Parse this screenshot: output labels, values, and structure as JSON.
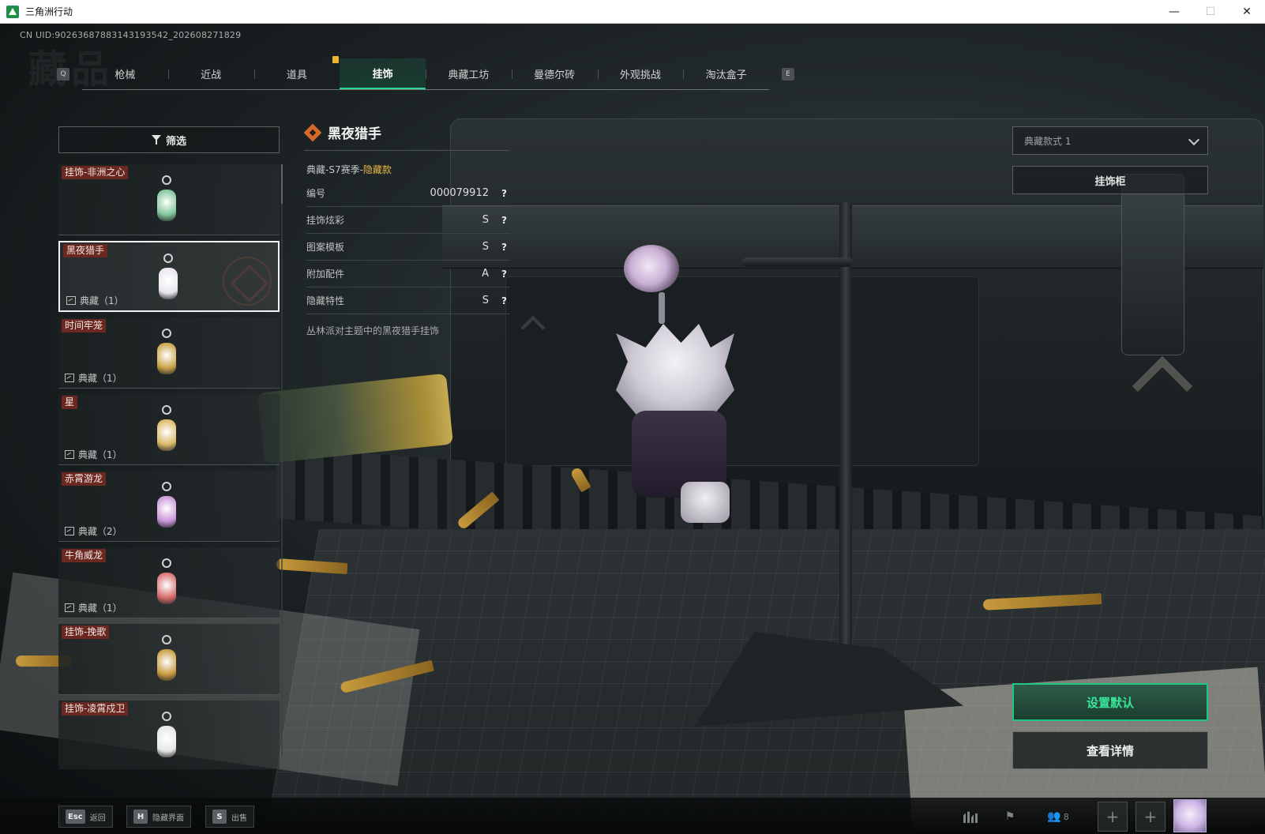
{
  "window": {
    "title": "三角洲行动",
    "controls": {
      "minimize": "—",
      "maximize": "☐",
      "close": "✕"
    }
  },
  "header": {
    "uid": "CN UID:9026368788314319354​2_202608271829",
    "watermark": "藏品",
    "key_left": "Q",
    "key_right": "E"
  },
  "tabs": [
    {
      "label": "枪械"
    },
    {
      "label": "近战"
    },
    {
      "label": "道具"
    },
    {
      "label": "挂饰",
      "active": true
    },
    {
      "label": "典藏工坊"
    },
    {
      "label": "曼德尔砖"
    },
    {
      "label": "外观挑战"
    },
    {
      "label": "淘汰盒子"
    }
  ],
  "filter": {
    "label": "筛选"
  },
  "items": [
    {
      "name": "挂饰-非洲之心",
      "tag": "",
      "thumb_color": "#7fc59a"
    },
    {
      "name": "黑夜猎手",
      "tag": "典藏（1）",
      "selected": true,
      "thumb_color": "#e8e6ec"
    },
    {
      "name": "时间牢笼",
      "tag": "典藏（1）",
      "thumb_color": "#c9a246"
    },
    {
      "name": "星",
      "tag": "典藏（1）",
      "thumb_color": "#d9b866"
    },
    {
      "name": "赤霄游龙",
      "tag": "典藏（2）",
      "thumb_color": "#c996d9"
    },
    {
      "name": "牛角威龙",
      "tag": "典藏（1）",
      "thumb_color": "#d86c6c"
    },
    {
      "name": "挂饰-挽歌",
      "tag": "",
      "thumb_color": "#c99a40"
    },
    {
      "name": "挂饰-凌霄戍卫",
      "tag": "",
      "thumb_color": "#e6e6e6"
    }
  ],
  "detail": {
    "title": "黑夜猎手",
    "season_prefix": "典藏-S7赛季-",
    "season_highlight": "隐藏款",
    "attributes": [
      {
        "label": "编号",
        "value": "000079912"
      },
      {
        "label": "挂饰炫彩",
        "value": "S"
      },
      {
        "label": "图案模板",
        "value": "S"
      },
      {
        "label": "附加配件",
        "value": "A"
      },
      {
        "label": "隐藏特性",
        "value": "S"
      }
    ],
    "help_glyph": "?",
    "description": "丛林派对主题中的黑夜猎手挂饰"
  },
  "right_panel": {
    "variant_select": "典藏款式 1",
    "cabinet_button": "挂饰柜",
    "default_button": "设置默认",
    "details_button": "查看详情"
  },
  "bottom": {
    "hints": [
      {
        "key": "Esc",
        "label": "返回"
      },
      {
        "key": "H",
        "label": "隐藏界面"
      },
      {
        "key": "S",
        "label": "出售"
      }
    ],
    "friends_count": "8",
    "plus": "+"
  },
  "colors": {
    "accent_green": "#22c67f",
    "name_tag": "#6b2820",
    "season_highlight": "#e8b944"
  }
}
